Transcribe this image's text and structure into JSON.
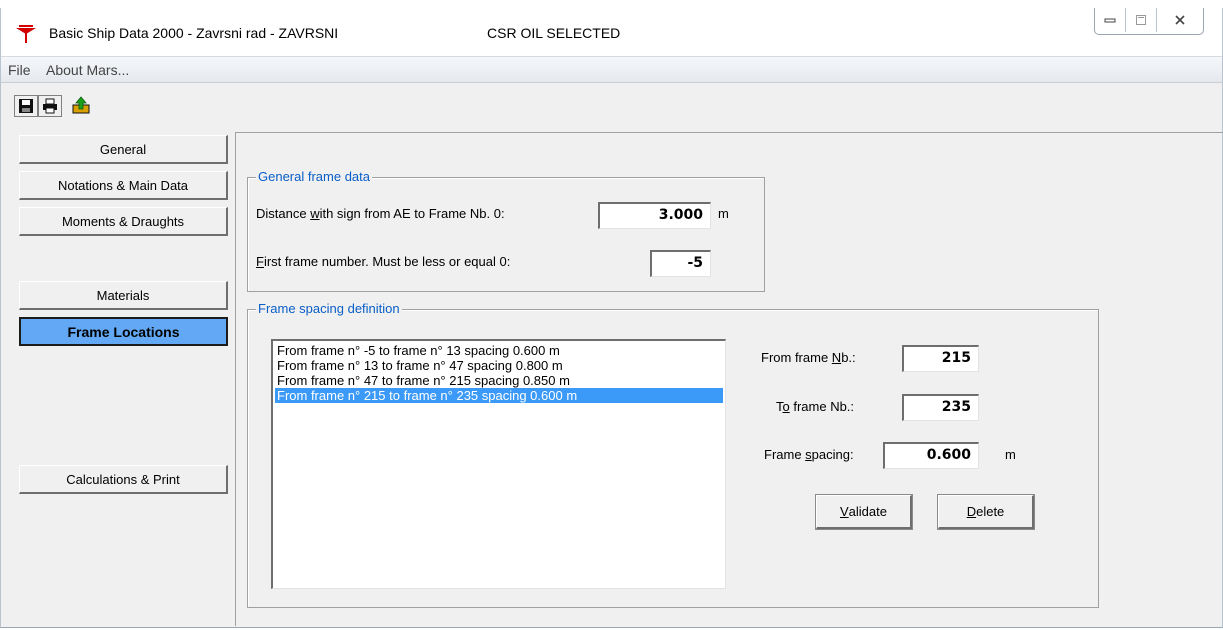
{
  "window": {
    "title": "Basic Ship Data 2000 - Zavrsni rad - ZAVRSNI",
    "selection": "CSR OIL SELECTED"
  },
  "menu": {
    "file": "File",
    "about": "About Mars..."
  },
  "toolbar": {
    "icons": [
      "save-icon",
      "print-icon",
      "export-icon"
    ]
  },
  "nav": {
    "general": "General",
    "notations": "Notations & Main Data",
    "moments": "Moments & Draughts",
    "materials": "Materials",
    "frame_locations": "Frame Locations",
    "calculations": "Calculations & Print"
  },
  "general_frame": {
    "legend": "General frame data",
    "distance_label_pre": "Distance ",
    "distance_label_ul": "w",
    "distance_label_post": "ith sign from AE to Frame Nb. 0:",
    "distance_value": "3.000",
    "distance_unit": "m",
    "first_label_ul": "F",
    "first_label_post": "irst frame number. Must be less or equal 0:",
    "first_value": "-5"
  },
  "spacing": {
    "legend": "Frame spacing definition",
    "items": [
      "From frame n° -5 to frame n° 13 spacing 0.600 m",
      "From frame n° 13 to frame n° 47 spacing 0.800 m",
      "From frame n° 47 to frame n° 215 spacing 0.850 m",
      "From frame n° 215 to frame n° 235 spacing 0.600 m"
    ],
    "selected_index": 3,
    "from_label_pre": "From frame ",
    "from_label_ul": "N",
    "from_label_post": "b.:",
    "from_value": "215",
    "to_label_pre": "T",
    "to_label_ul": "o",
    "to_label_post": " frame Nb.:",
    "to_value": "235",
    "spacing_label_pre": "Frame ",
    "spacing_label_ul": "s",
    "spacing_label_post": "pacing:",
    "spacing_value": "0.600",
    "spacing_unit": "m",
    "validate_ul": "V",
    "validate_post": "alidate",
    "delete_ul": "D",
    "delete_post": "elete"
  }
}
